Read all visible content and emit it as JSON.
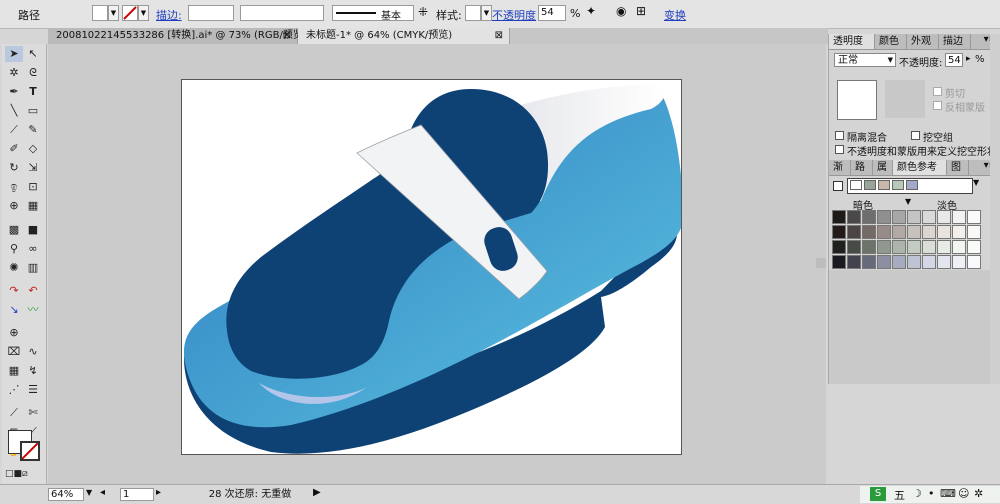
{
  "control_bar": {
    "object_type": "路径",
    "stroke_link": "描边:",
    "stroke_profile": "基本",
    "style_label": "样式:",
    "opacity_link": "不透明度",
    "opacity_value": "54",
    "percent": "%",
    "transform_link": "变换"
  },
  "tabs": [
    {
      "label": "20081022145533286 [转换].ai* @ 73% (RGB/预览)",
      "close": "⊠"
    },
    {
      "label": "未标题-1* @ 64% (CMYK/预览)",
      "close": "⊠"
    }
  ],
  "transparency_panel": {
    "tabs": [
      "透明度",
      "颜色",
      "外观",
      "描边"
    ],
    "blend_mode": "正常",
    "opacity_label": "不透明度:",
    "opacity_value": "54",
    "percent": "%",
    "clip_label": "剪切",
    "invert_mask_label": "反相蒙版",
    "isolate_blending_label": "隔离混合",
    "knockout_group_label": "挖空组",
    "opacity_mask_label": "不透明度和蒙版用来定义挖空形状"
  },
  "color_guide_panel": {
    "tabs": [
      "渐",
      "路",
      "属",
      "颜色参考",
      "图"
    ],
    "shades_label": "暗色",
    "tints_label": "淡色",
    "grid_colors": [
      [
        "#1e1a18",
        "#4a4848",
        "#6e6e6e",
        "#8f8f8f",
        "#a7a7a7",
        "#c4c4c4",
        "#d9d9d9",
        "#e8e8e8",
        "#f2f2f2",
        "#fafafa"
      ],
      [
        "#221b17",
        "#4b4442",
        "#736a66",
        "#978c88",
        "#b3a9a4",
        "#c9c1bb",
        "#dcd5d0",
        "#e9e4df",
        "#f3efeb",
        "#faf8f6"
      ],
      [
        "#1d201c",
        "#464c45",
        "#6c746a",
        "#8f998d",
        "#abb5a9",
        "#c3ccc1",
        "#d8e0d6",
        "#e7ede5",
        "#f1f6f0",
        "#f9fbf8"
      ],
      [
        "#1a1b22",
        "#42434f",
        "#676a7a",
        "#8b8fa1",
        "#a6abbf",
        "#bfc4d5",
        "#d4d8e6",
        "#e3e6ef",
        "#eef0f6",
        "#f8f9fb"
      ]
    ],
    "guide_strip": [
      "#ffffff",
      "#9aa39a",
      "#c9b8aa",
      "#b9c9b7",
      "#a3a9c6"
    ]
  },
  "status_bar": {
    "zoom": "64%",
    "page": "1",
    "status_text": "28 次还原: 无重做"
  },
  "taskbar": {
    "ime_label": "五"
  },
  "colors": {
    "shoe_dark": "#0e4275",
    "shoe_light_top": "#2c7cc0",
    "shoe_light_bottom": "#5dc3e0",
    "strap_white": "#f2f3f5",
    "shine": "#b3c6ea"
  }
}
